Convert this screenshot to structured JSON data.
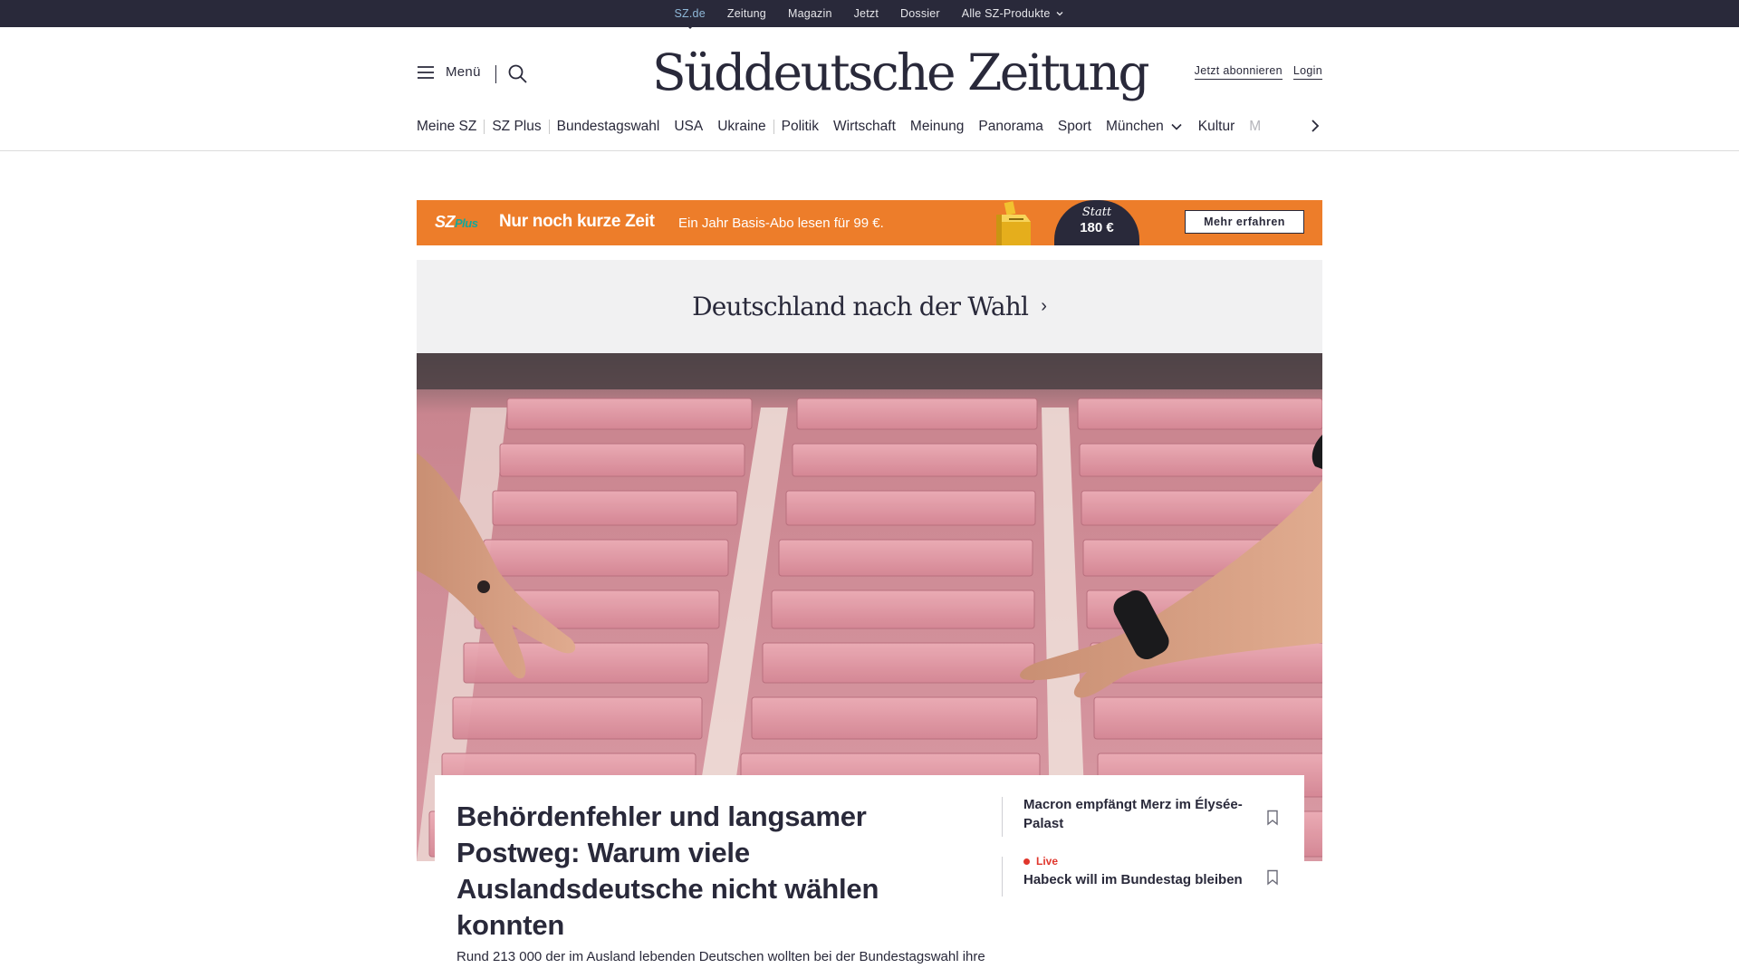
{
  "topbar": {
    "links": [
      "SZ.de",
      "Zeitung",
      "Magazin",
      "Jetzt",
      "Dossier",
      "Alle SZ-Produkte"
    ],
    "active": "SZ.de"
  },
  "header": {
    "menu_label": "Menü",
    "logo_text": "Süddeutsche Zeitung",
    "subscribe_label": "Jetzt abonnieren",
    "login_label": "Login"
  },
  "nav": {
    "items": [
      "Meine SZ",
      "SZ Plus",
      "Bundestagswahl",
      "USA",
      "Ukraine",
      "Politik",
      "Wirtschaft",
      "Meinung",
      "Panorama",
      "Sport",
      "München",
      "Kultur",
      "M"
    ]
  },
  "promo": {
    "brand": "SZ",
    "brand_plus": "Plus",
    "headline": "Nur noch kurze Zeit",
    "subline": "Ein Jahr Basis-Abo lesen für 99 €.",
    "price_label": "Statt",
    "price_value": "180 €",
    "cta_label": "Mehr erfahren",
    "colors": {
      "background": "#ed7d2a",
      "dark": "#29293a",
      "plus": "#14a89a"
    }
  },
  "section": {
    "title": "Deutschland nach der Wahl"
  },
  "lead_story": {
    "title": "Behördenfehler und langsamer Postweg: Warum viele Auslandsdeutsche nicht wählen konnten",
    "teaser": "Rund 213 000 der im Ausland lebenden Deutschen wollten bei der Bundestagswahl ihre"
  },
  "side_stories": [
    {
      "title": "Macron empfängt Merz im Élysée-Palast",
      "live": ""
    },
    {
      "title": "Habeck will im Bundestag bleiben",
      "live": "Live"
    }
  ],
  "colors": {
    "ink": "#29293a",
    "topbar_active": "#8fb8d8",
    "live": "#e0362c",
    "section_bg": "#f1f1f2"
  }
}
